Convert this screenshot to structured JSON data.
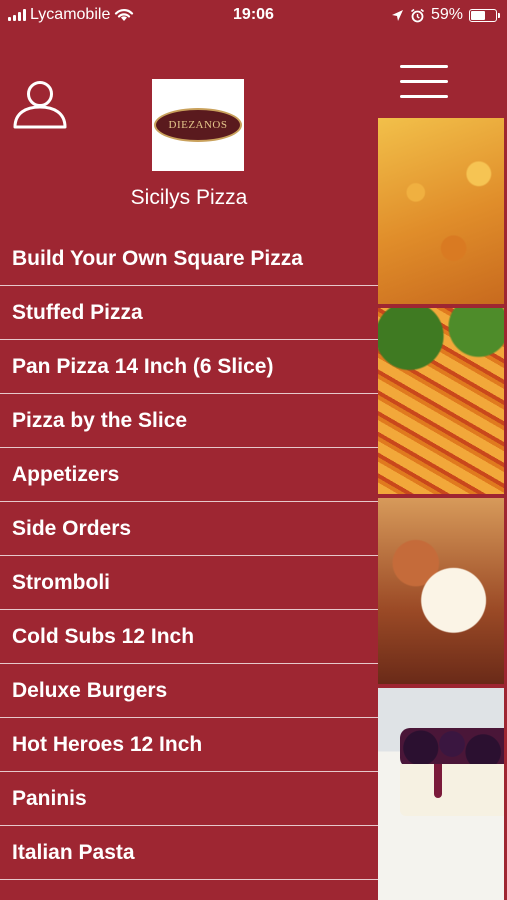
{
  "status": {
    "carrier": "Lycamobile",
    "time": "19:06",
    "battery": "59%",
    "battery_fraction": 0.59
  },
  "drawer": {
    "logo_text": "DIEZANOS",
    "store_name": "Sicilys Pizza",
    "menu_items": [
      "Build Your Own Square Pizza",
      "Stuffed Pizza",
      "Pan Pizza 14 Inch (6 Slice)",
      "Pizza by the Slice",
      "Appetizers",
      "Side Orders",
      "Stromboli",
      "Cold Subs 12 Inch",
      "Deluxe Burgers",
      "Hot Heroes 12 Inch",
      "Paninis",
      "Italian Pasta"
    ]
  },
  "colors": {
    "primary": "#9e2632",
    "divider": "#ffffff"
  },
  "icons": [
    "signal-icon",
    "wifi-icon",
    "location-arrow-icon",
    "alarm-icon",
    "battery-icon",
    "user-icon",
    "hamburger-menu-icon"
  ]
}
